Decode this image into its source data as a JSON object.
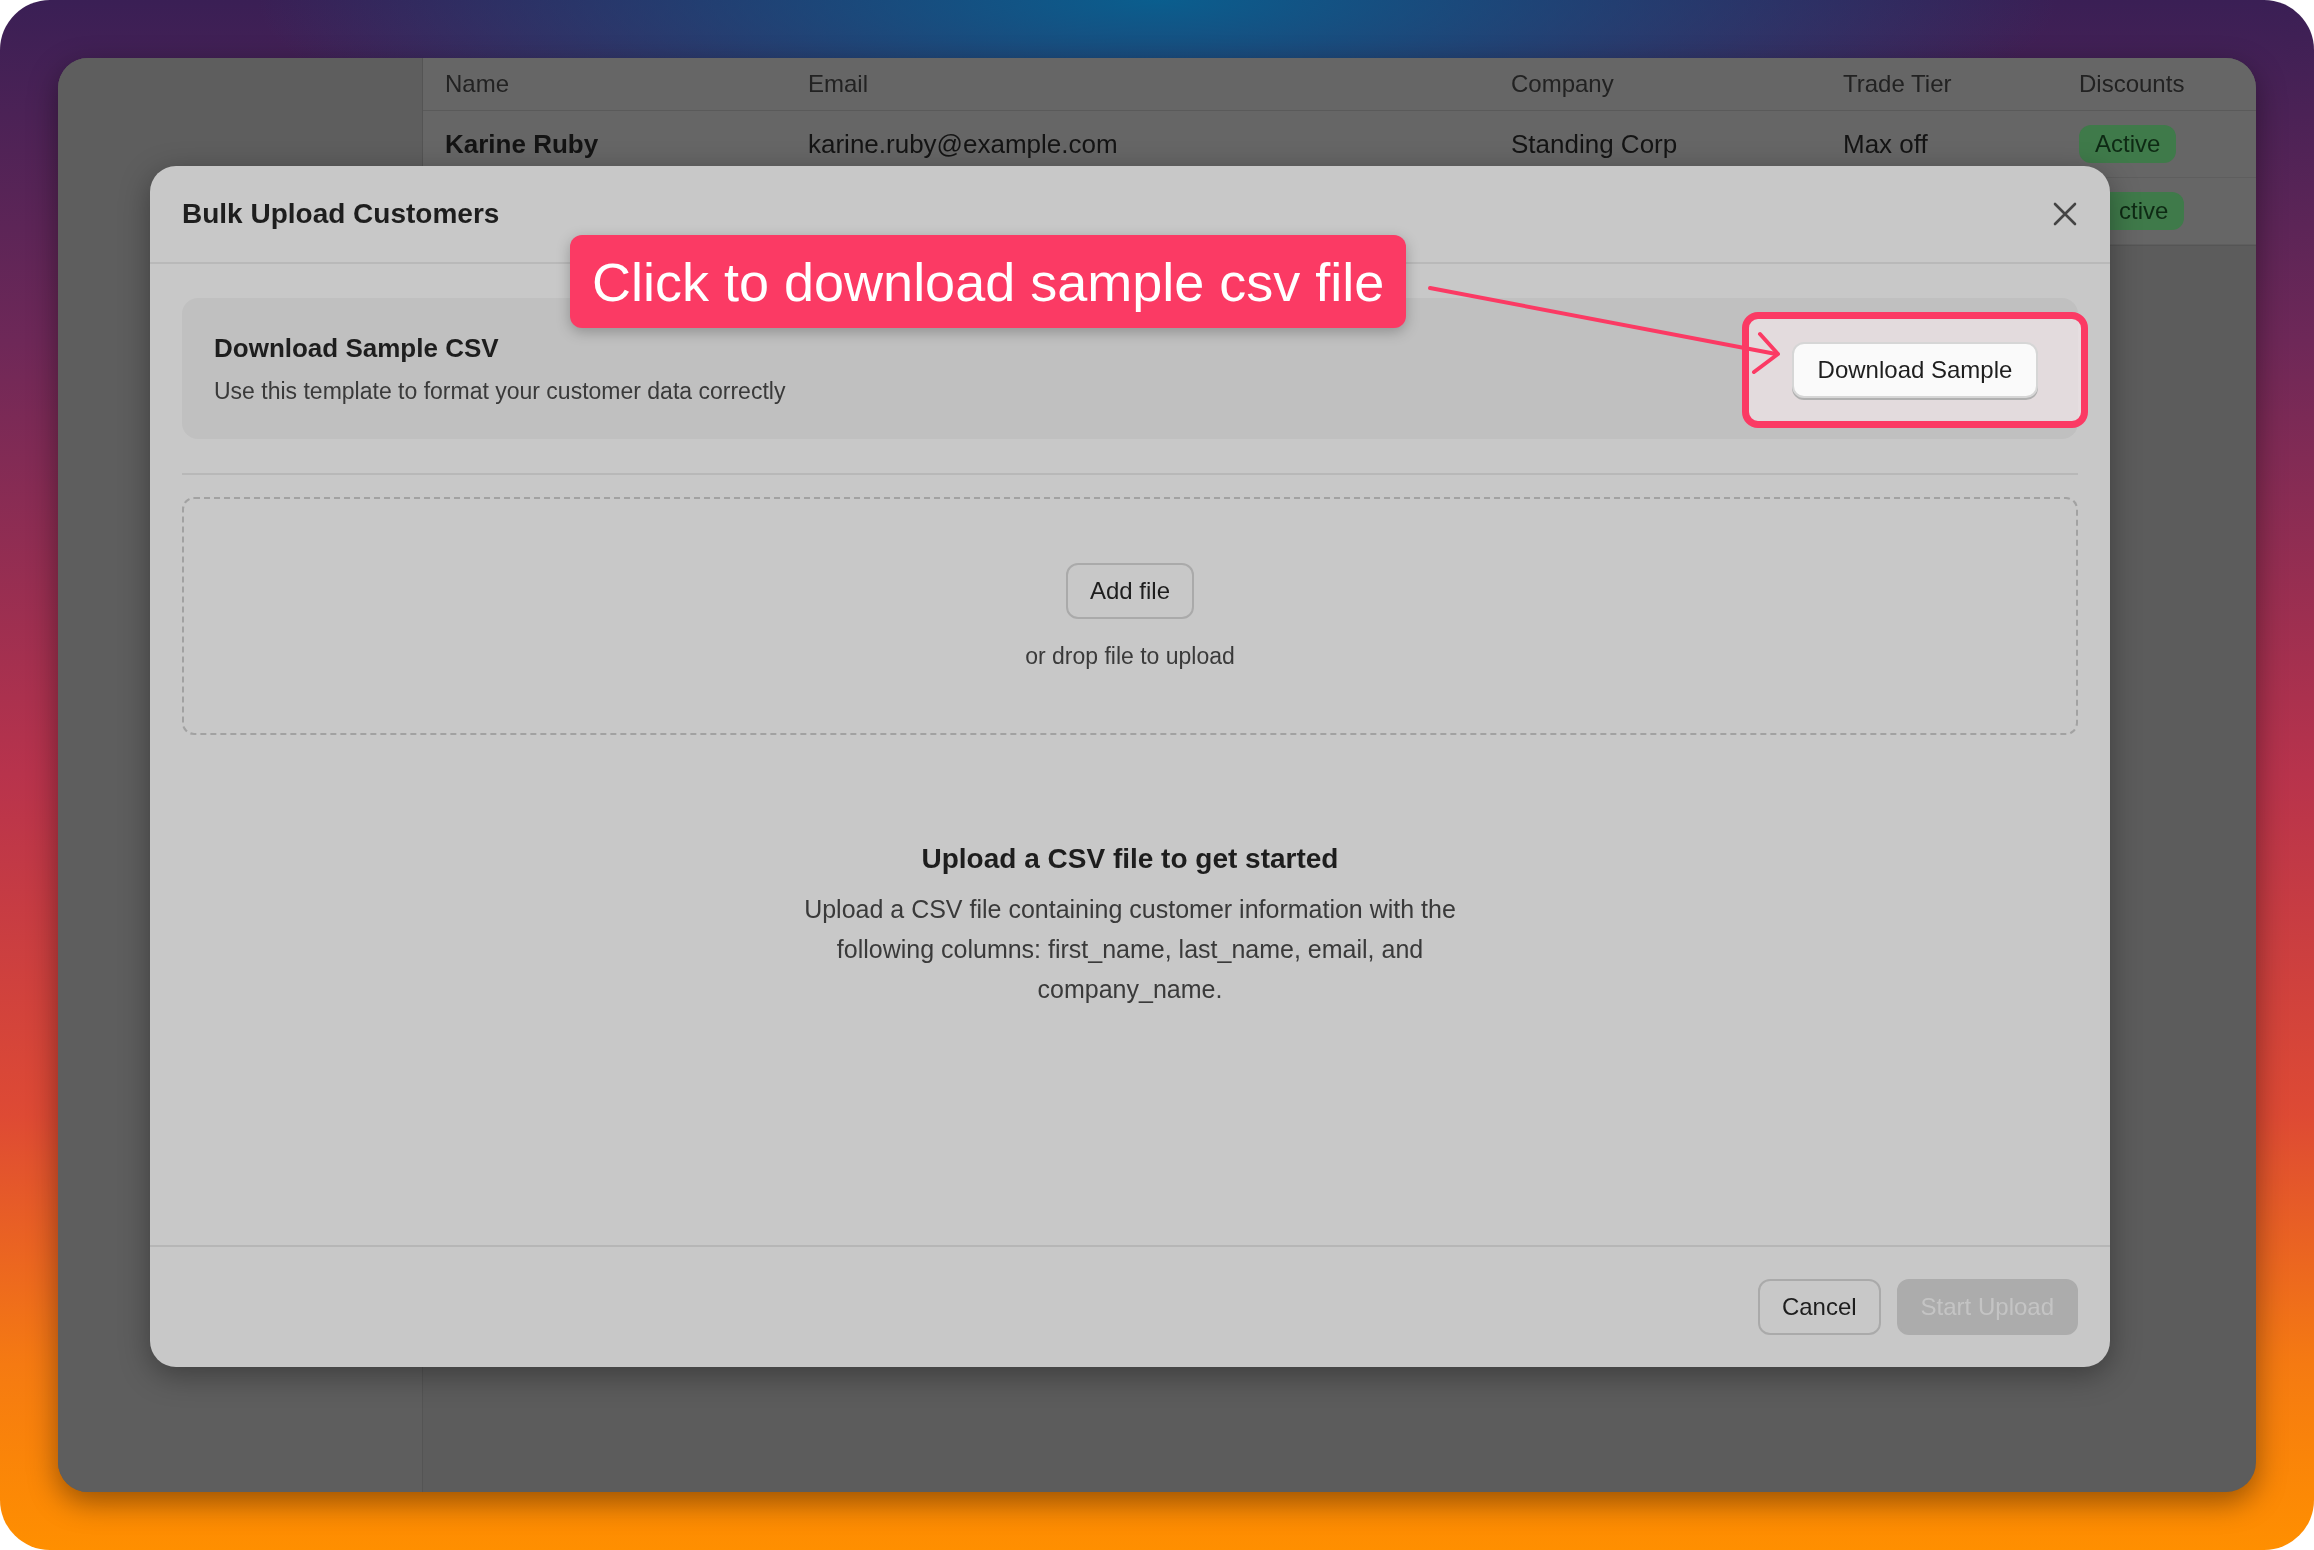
{
  "table": {
    "columns": [
      "Name",
      "Email",
      "Company",
      "Trade Tier",
      "Discounts"
    ],
    "rows": [
      {
        "name": "Karine Ruby",
        "email": "karine.ruby@example.com",
        "company": "Standing Corp",
        "trade_tier": "Max off",
        "discounts": "Active"
      },
      {
        "discounts": "ctive"
      }
    ]
  },
  "dialog": {
    "title": "Bulk Upload Customers",
    "sample": {
      "title": "Download Sample CSV",
      "description": "Use this template to format your customer data correctly",
      "button": "Download Sample"
    },
    "dropzone": {
      "button": "Add file",
      "hint": "or drop file to upload"
    },
    "empty_state": {
      "title": "Upload a CSV file to get started",
      "body": "Upload a CSV file containing customer information with the following columns: first_name, last_name, email, and company_name."
    },
    "footer_buttons": [
      {
        "label": "Cancel",
        "disabled": false
      },
      {
        "label": "Start Upload",
        "disabled": true
      }
    ]
  },
  "annotation": {
    "callout": "Click to download sample csv file"
  }
}
